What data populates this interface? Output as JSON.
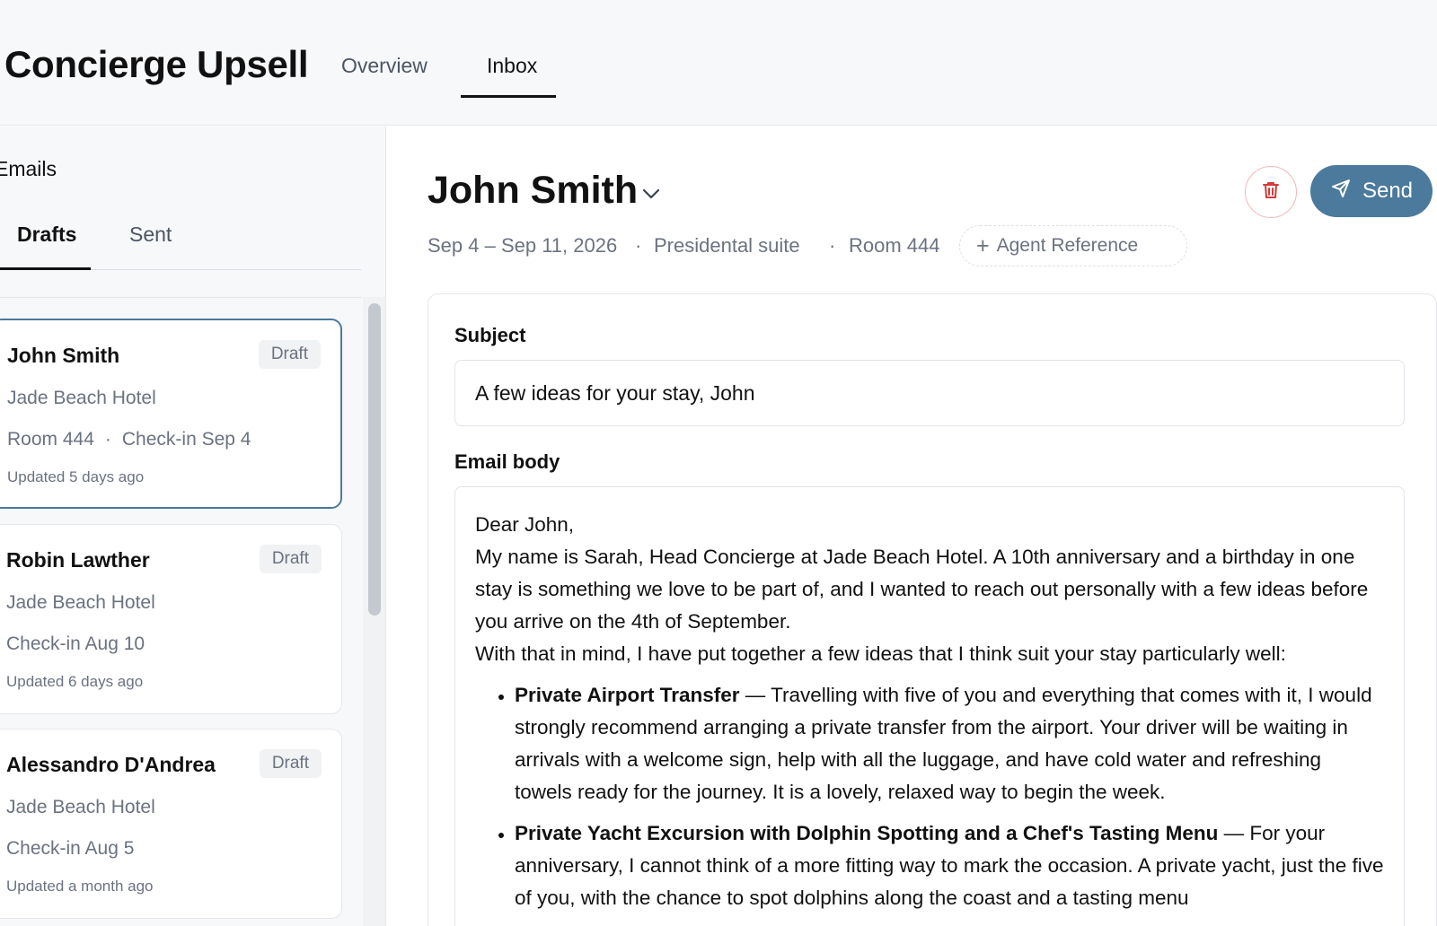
{
  "header": {
    "app_title": "Concierge Upsell",
    "tabs": [
      {
        "label": "Overview",
        "active": false
      },
      {
        "label": "Inbox",
        "active": true
      }
    ]
  },
  "sidebar": {
    "heading": "Emails",
    "tabs": [
      {
        "label": "Drafts",
        "active": true
      },
      {
        "label": "Sent",
        "active": false
      }
    ],
    "emails": [
      {
        "name": "John Smith",
        "status": "Draft",
        "hotel": "Jade Beach Hotel",
        "room": "Room 444",
        "checkin": "Check-in Sep 4",
        "updated": "Updated 5 days ago",
        "selected": true
      },
      {
        "name": "Robin Lawther",
        "status": "Draft",
        "hotel": "Jade Beach Hotel",
        "room": "",
        "checkin": "Check-in Aug 10",
        "updated": "Updated 6 days ago",
        "selected": false
      },
      {
        "name": "Alessandro D'Andrea",
        "status": "Draft",
        "hotel": "Jade Beach Hotel",
        "room": "",
        "checkin": "Check-in Aug 5",
        "updated": "Updated a month ago",
        "selected": false
      }
    ]
  },
  "detail": {
    "guest_name": "John Smith",
    "dates": "Sep 4 – Sep 11, 2026",
    "separator": "·",
    "room_type": "Presidental suite",
    "room": "Room 444",
    "agent_reference_label": "Agent Reference",
    "send_label": "Send",
    "subject_label": "Subject",
    "subject_value": "A few ideas for your stay, John",
    "body_label": "Email body",
    "body": {
      "greeting": "Dear John,",
      "intro": "My name is Sarah, Head Concierge at Jade Beach Hotel. A 10th anniversary and a birthday in one stay is something we love to be part of, and I wanted to reach out personally with a few ideas before you arrive on the 4th of September.",
      "lead_in": "With that in mind, I have put together a few ideas that I think suit your stay particularly well:",
      "items": [
        {
          "title": "Private Airport Transfer",
          "text": " — Travelling with five of you and everything that comes with it, I would strongly recommend arranging a private transfer from the airport. Your driver will be waiting in arrivals with a welcome sign, help with all the luggage, and have cold water and refreshing towels ready for the journey. It is a lovely, relaxed way to begin the week."
        },
        {
          "title": "Private Yacht Excursion with Dolphin Spotting and a Chef's Tasting Menu",
          "text": " — For your anniversary, I cannot think of a more fitting way to mark the occasion. A private yacht, just the five of you, with the chance to spot dolphins along the coast and a tasting menu"
        }
      ]
    }
  },
  "colors": {
    "accent": "#4b7a9c",
    "delete": "#d33a3a",
    "muted_text": "#6b7280",
    "header_bg": "#f7f8fa"
  },
  "icons": [
    "chevron-down-icon",
    "trash-icon",
    "send-icon",
    "plus-icon"
  ]
}
